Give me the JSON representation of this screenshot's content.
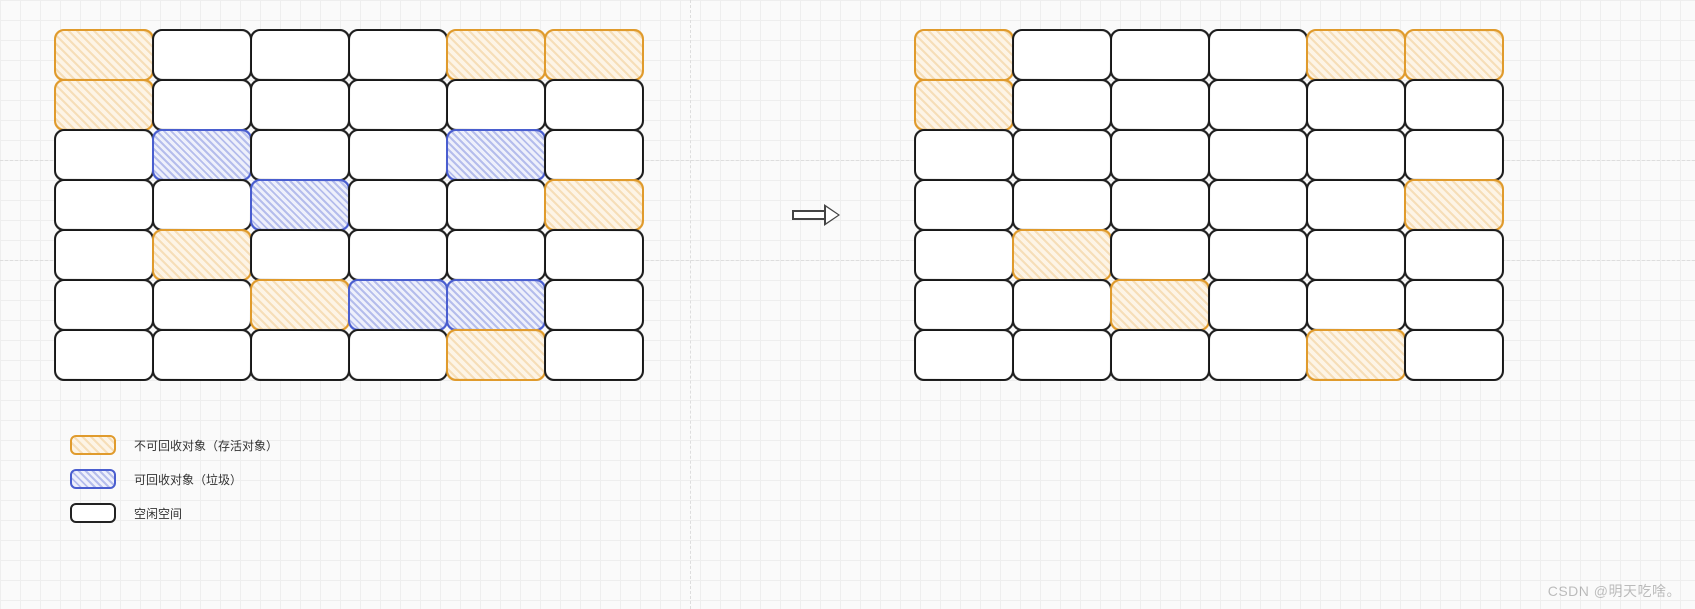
{
  "legend": {
    "unrecyclable": "不可回收对象（存活对象）",
    "recyclable": "可回收对象（垃圾）",
    "free": "空闲空间"
  },
  "watermark": "CSDN @明天吃啥。",
  "colors": {
    "unrecyclable_border": "#e09b2d",
    "recyclable_border": "#4a5ecf",
    "free_border": "#222222"
  },
  "chart_data": {
    "type": "table",
    "title": "Mark-Sweep Garbage Collection Before/After",
    "states": [
      "unrecyclable",
      "recyclable",
      "free"
    ],
    "grid_size": {
      "rows": 7,
      "cols": 6
    },
    "arrow": "before → after",
    "before_grid": [
      [
        "unrecyclable",
        "free",
        "free",
        "free",
        "unrecyclable",
        "unrecyclable"
      ],
      [
        "unrecyclable",
        "free",
        "free",
        "free",
        "free",
        "free"
      ],
      [
        "free",
        "recyclable",
        "free",
        "free",
        "recyclable",
        "free"
      ],
      [
        "free",
        "free",
        "recyclable",
        "free",
        "free",
        "unrecyclable"
      ],
      [
        "free",
        "unrecyclable",
        "free",
        "free",
        "free",
        "free"
      ],
      [
        "free",
        "free",
        "unrecyclable",
        "recyclable",
        "recyclable",
        "free"
      ],
      [
        "free",
        "free",
        "free",
        "free",
        "unrecyclable",
        "free"
      ]
    ],
    "after_grid": [
      [
        "unrecyclable",
        "free",
        "free",
        "free",
        "unrecyclable",
        "unrecyclable"
      ],
      [
        "unrecyclable",
        "free",
        "free",
        "free",
        "free",
        "free"
      ],
      [
        "free",
        "free",
        "free",
        "free",
        "free",
        "free"
      ],
      [
        "free",
        "free",
        "free",
        "free",
        "free",
        "unrecyclable"
      ],
      [
        "free",
        "unrecyclable",
        "free",
        "free",
        "free",
        "free"
      ],
      [
        "free",
        "free",
        "unrecyclable",
        "free",
        "free",
        "free"
      ],
      [
        "free",
        "free",
        "free",
        "free",
        "unrecyclable",
        "free"
      ]
    ]
  }
}
